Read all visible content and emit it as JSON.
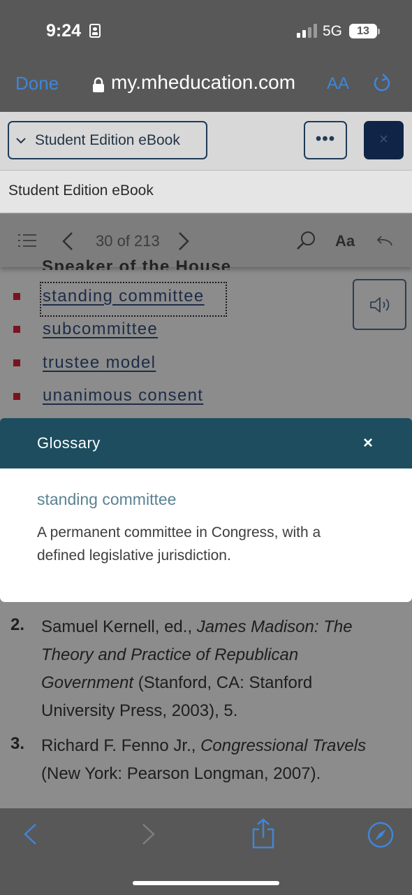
{
  "status_bar": {
    "time": "9:24",
    "network": "5G",
    "battery": "13"
  },
  "browser": {
    "done_label": "Done",
    "url": "my.mheducation.com",
    "text_size_label": "AA"
  },
  "app_toolbar": {
    "dropdown_label": "Student Edition eBook",
    "more_label": "•••",
    "close_label": "×"
  },
  "book_title": "Student Edition eBook",
  "reader": {
    "page_indicator": "30 of 213",
    "font_label": "Aa"
  },
  "list": {
    "clipped_term": "Speaker of the House",
    "items": [
      "standing committee",
      "subcommittee",
      "trustee model",
      "unanimous consent"
    ]
  },
  "glossary": {
    "title": "Glossary",
    "close_label": "×",
    "term": "standing committee",
    "definition": "A permanent committee in Congress, with a defined legislative jurisdiction."
  },
  "references": [
    {
      "num": "2.",
      "author": "Samuel Kernell, ed., ",
      "work_title": "James Madison: The Theory and Practice of Republican Government",
      "details": " (Stanford, CA: Stanford University Press, 2003), 5."
    },
    {
      "num": "3.",
      "author": "Richard F. Fenno Jr., ",
      "work_title": "Congressional Travels",
      "details": " (New York: Pearson Longman, 2007)."
    }
  ],
  "colors": {
    "accent": "#3f86d8",
    "glossary_header": "#1d4d5f",
    "bullet": "#7a1320",
    "nav_blue": "#0f2446"
  }
}
